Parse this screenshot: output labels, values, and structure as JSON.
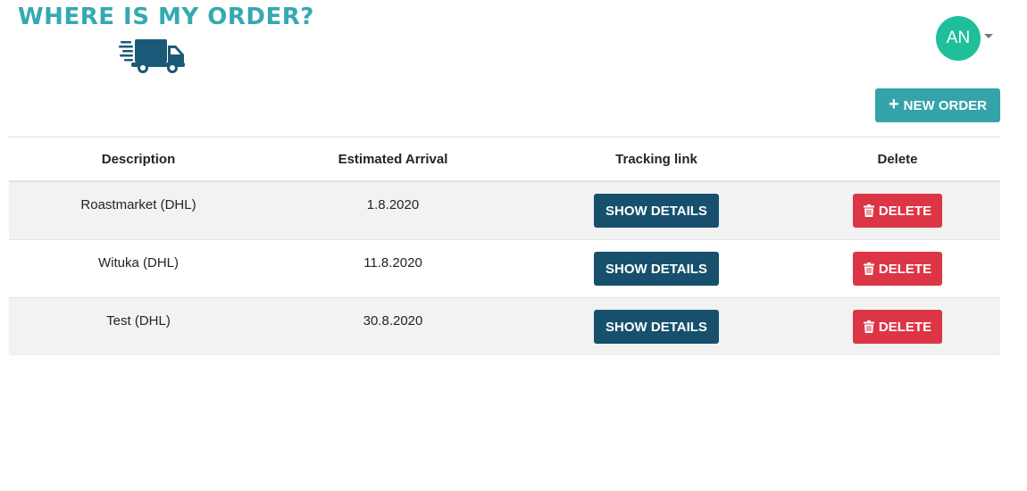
{
  "app": {
    "logo_text": "WHERE IS MY ORDER?",
    "brand_color": "#35a9b1",
    "logo_icon": "delivery-truck-icon"
  },
  "user": {
    "initials": "AN",
    "avatar_color": "#1fbf9c"
  },
  "toolbar": {
    "new_order_label": "NEW ORDER",
    "new_order_icon": "plus-icon",
    "new_order_color": "#35a3aa"
  },
  "table": {
    "headers": {
      "description": "Description",
      "estimated_arrival": "Estimated Arrival",
      "tracking_link": "Tracking link",
      "delete": "Delete"
    },
    "rows": [
      {
        "description": "Roastmarket (DHL)",
        "estimated_arrival": "1.8.2020",
        "tracking_label": "SHOW DETAILS",
        "delete_label": "DELETE"
      },
      {
        "description": "Wituka (DHL)",
        "estimated_arrival": "11.8.2020",
        "tracking_label": "SHOW DETAILS",
        "delete_label": "DELETE"
      },
      {
        "description": "Test (DHL)",
        "estimated_arrival": "30.8.2020",
        "tracking_label": "SHOW DETAILS",
        "delete_label": "DELETE"
      }
    ]
  },
  "colors": {
    "show_details": "#16506c",
    "delete": "#dc3545",
    "stripe": "#f2f2f2"
  }
}
